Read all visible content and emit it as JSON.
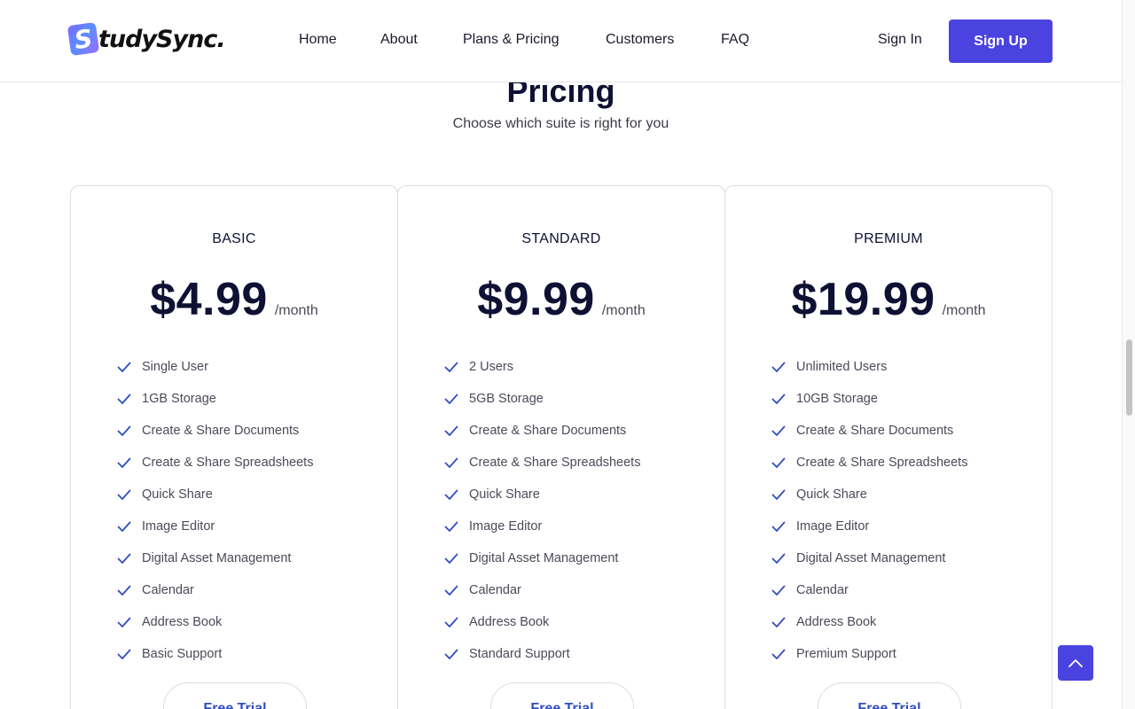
{
  "brand": {
    "name": "tudySync.",
    "mark_letter": "S",
    "accent_color": "#4b43e0"
  },
  "nav": {
    "items": [
      "Home",
      "About",
      "Plans & Pricing",
      "Customers",
      "FAQ"
    ],
    "sign_in": "Sign In",
    "sign_up": "Sign Up"
  },
  "pricing": {
    "title": "Pricing",
    "subtitle": "Choose which suite is right for you",
    "plans": [
      {
        "name": "BASIC",
        "price": "$4.99",
        "period": "/month",
        "features": [
          "Single User",
          "1GB Storage",
          "Create & Share Documents",
          "Create & Share Spreadsheets",
          "Quick Share",
          "Image Editor",
          "Digital Asset Management",
          "Calendar",
          "Address Book",
          "Basic Support"
        ],
        "cta": "Free Trial"
      },
      {
        "name": "STANDARD",
        "price": "$9.99",
        "period": "/month",
        "features": [
          "2 Users",
          "5GB Storage",
          "Create & Share Documents",
          "Create & Share Spreadsheets",
          "Quick Share",
          "Image Editor",
          "Digital Asset Management",
          "Calendar",
          "Address Book",
          "Standard Support"
        ],
        "cta": "Free Trial"
      },
      {
        "name": "PREMIUM",
        "price": "$19.99",
        "period": "/month",
        "features": [
          "Unlimited Users",
          "10GB Storage",
          "Create & Share Documents",
          "Create & Share Spreadsheets",
          "Quick Share",
          "Image Editor",
          "Digital Asset Management",
          "Calendar",
          "Address Book",
          "Premium Support"
        ],
        "cta": "Free Trial"
      }
    ]
  },
  "icons": {
    "feature": "check-icon",
    "back_to_top": "chevron-up-icon"
  }
}
